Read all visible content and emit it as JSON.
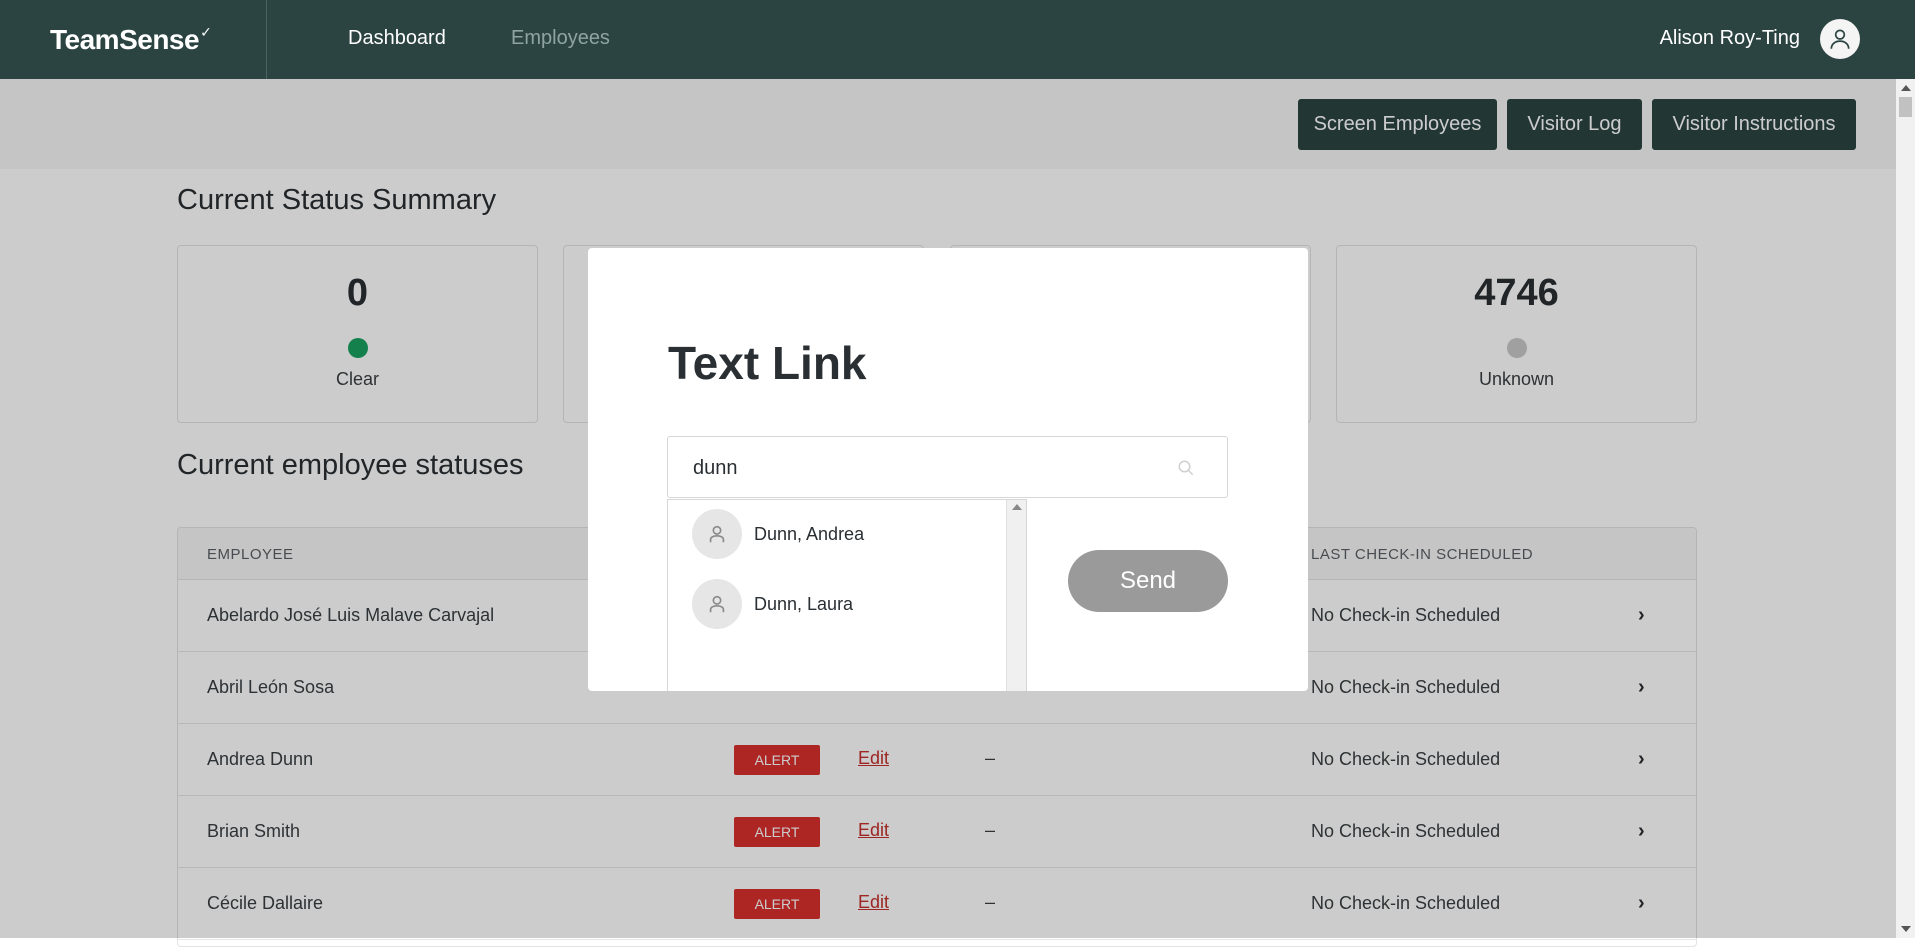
{
  "colors": {
    "nav_bg": "#2b4442",
    "clear": "#1aa260",
    "unknown": "#c8c8c8",
    "alert": "#d9302e"
  },
  "nav": {
    "logo": "TeamSense",
    "links": [
      "Dashboard",
      "Employees"
    ],
    "user_name": "Alison Roy-Ting"
  },
  "actions": {
    "screen_employees": "Screen Employees",
    "visitor_log": "Visitor Log",
    "visitor_instructions": "Visitor Instructions"
  },
  "summary": {
    "title": "Current Status Summary",
    "cards": [
      {
        "count": "0",
        "label": "Clear"
      },
      {
        "count": "4746",
        "label": "Unknown"
      }
    ]
  },
  "statuses": {
    "title": "Current employee statuses",
    "headers": {
      "employee": "EMPLOYEE",
      "last_checkin": "LAST CHECK-IN SCHEDULED"
    },
    "rows": [
      {
        "name": "Abelardo José Luis Malave Carvajal",
        "last": "No Check-in Scheduled"
      },
      {
        "name": "Abril León Sosa",
        "last": "No Check-in Scheduled"
      },
      {
        "name": "Andrea Dunn",
        "badge": "ALERT",
        "edit": "Edit",
        "dash": "–",
        "last": "No Check-in Scheduled"
      },
      {
        "name": "Brian Smith",
        "badge": "ALERT",
        "edit": "Edit",
        "dash": "–",
        "last": "No Check-in Scheduled"
      },
      {
        "name": "Cécile Dallaire",
        "badge": "ALERT",
        "edit": "Edit",
        "dash": "–",
        "last": "No Check-in Scheduled"
      }
    ]
  },
  "modal": {
    "title": "Text Link",
    "search_value": "dunn",
    "results": [
      "Dunn, Andrea",
      "Dunn, Laura"
    ],
    "send_label": "Send"
  }
}
